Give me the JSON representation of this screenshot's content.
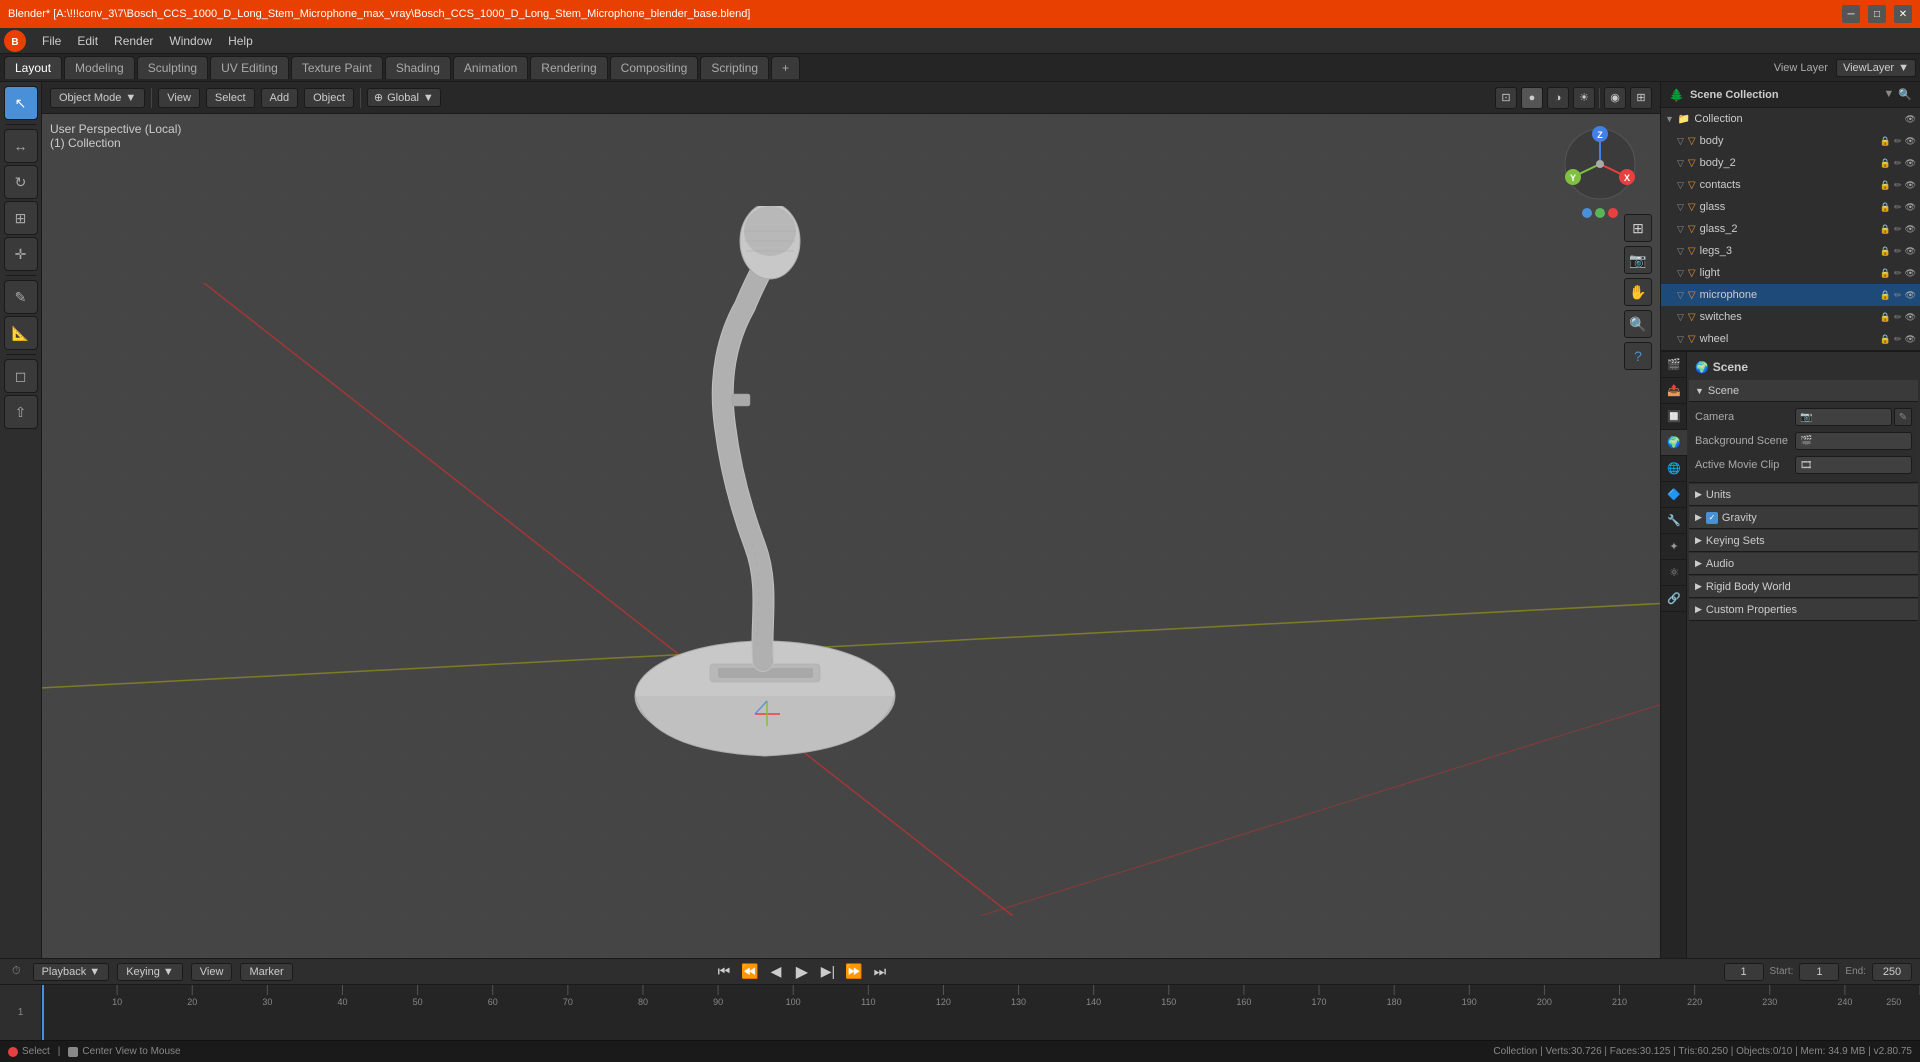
{
  "window": {
    "title": "Blender* [A:\\!!!conv_3\\7\\Bosch_CCS_1000_D_Long_Stem_Microphone_max_vray\\Bosch_CCS_1000_D_Long_Stem_Microphone_blender_base.blend]"
  },
  "menu": {
    "logo": "B",
    "items": [
      "File",
      "Edit",
      "Render",
      "Window",
      "Help"
    ]
  },
  "workspace_tabs": {
    "tabs": [
      "Layout",
      "Modeling",
      "Sculpting",
      "UV Editing",
      "Texture Paint",
      "Shading",
      "Animation",
      "Rendering",
      "Compositing",
      "Scripting",
      "+"
    ],
    "active": "Layout"
  },
  "view_layer": {
    "label": "View Layer",
    "value": "ViewLayer"
  },
  "viewport": {
    "mode_label": "Object Mode",
    "view_label": "User Perspective (Local)",
    "collection_label": "(1) Collection",
    "global_local": "Global",
    "header_icons": [
      "⊞",
      "⊕",
      "☉",
      "⊙",
      "△",
      "⊞"
    ]
  },
  "toolbar": {
    "tools": [
      "↖",
      "↔",
      "↕",
      "↻",
      "⊞",
      "◎",
      "✎",
      "✂"
    ]
  },
  "outliner": {
    "title": "Scene Collection",
    "items": [
      {
        "name": "Collection",
        "indent": 0,
        "icon": "▽",
        "color": "none",
        "type": "collection"
      },
      {
        "name": "body",
        "indent": 1,
        "icon": "▽",
        "color": "orange",
        "type": "mesh",
        "actions": "🔒✏"
      },
      {
        "name": "body_2",
        "indent": 1,
        "icon": "▽",
        "color": "orange",
        "type": "mesh",
        "actions": "🔒✏"
      },
      {
        "name": "contacts",
        "indent": 1,
        "icon": "▽",
        "color": "orange",
        "type": "mesh",
        "actions": "🔒✏"
      },
      {
        "name": "glass",
        "indent": 1,
        "icon": "▽",
        "color": "orange",
        "type": "mesh",
        "actions": "🔒✏"
      },
      {
        "name": "glass_2",
        "indent": 1,
        "icon": "▽",
        "color": "orange",
        "type": "mesh",
        "actions": "🔒✏"
      },
      {
        "name": "legs_3",
        "indent": 1,
        "icon": "▽",
        "color": "orange",
        "type": "mesh",
        "actions": "🔒✏"
      },
      {
        "name": "light",
        "indent": 1,
        "icon": "▽",
        "color": "orange",
        "type": "light",
        "actions": "🔒✏"
      },
      {
        "name": "microphone",
        "indent": 1,
        "icon": "▽",
        "color": "orange",
        "type": "mesh",
        "actions": "🔒✏"
      },
      {
        "name": "switches",
        "indent": 1,
        "icon": "▽",
        "color": "orange",
        "type": "mesh",
        "actions": "🔒✏"
      },
      {
        "name": "wheel",
        "indent": 1,
        "icon": "▽",
        "color": "orange",
        "type": "mesh",
        "actions": "🔒✏"
      }
    ]
  },
  "properties": {
    "tabs": [
      "🎬",
      "📷",
      "✦",
      "🌍",
      "🔧",
      "🎭",
      "🔷",
      "🧲",
      "⚙"
    ],
    "active_tab": "🌍",
    "scene_label": "Scene",
    "sections": [
      {
        "name": "Scene",
        "collapsed": false,
        "fields": [
          {
            "label": "Camera",
            "value": "",
            "icon": "📷"
          },
          {
            "label": "Background Scene",
            "value": "",
            "icon": "🎬"
          },
          {
            "label": "Active Movie Clip",
            "value": "",
            "icon": "🎞"
          }
        ]
      },
      {
        "name": "Units",
        "collapsed": true,
        "fields": []
      },
      {
        "name": "Gravity",
        "collapsed": true,
        "checked": true,
        "fields": []
      },
      {
        "name": "Keying Sets",
        "collapsed": true,
        "fields": []
      },
      {
        "name": "Audio",
        "collapsed": true,
        "fields": []
      },
      {
        "name": "Rigid Body World",
        "collapsed": true,
        "fields": []
      },
      {
        "name": "Custom Properties",
        "collapsed": true,
        "fields": []
      }
    ]
  },
  "timeline": {
    "playback_label": "Playback",
    "keying_label": "Keying",
    "view_label": "View",
    "marker_label": "Marker",
    "current_frame": "1",
    "start_frame": "1",
    "end_frame": "250",
    "markers": [
      1,
      50,
      100,
      150,
      200,
      250
    ],
    "ruler_marks": [
      1,
      10,
      20,
      30,
      40,
      50,
      60,
      70,
      80,
      90,
      100,
      110,
      120,
      130,
      140,
      150,
      160,
      170,
      180,
      190,
      200,
      210,
      220,
      230,
      240,
      250
    ]
  },
  "status_bar": {
    "left": "● Select",
    "middle": "⊕ Center View to Mouse",
    "right": "Collection | Verts:30.726 | Faces:30.125 | Tris:60.250 | Objects:0/10 | Mem: 34.9 MB | v2.80.75"
  },
  "nav_gizmo": {
    "x_color": "#e84040",
    "y_color": "#80c040",
    "z_color": "#4080e8"
  },
  "colors": {
    "accent": "#4a90d9",
    "orange": "#e8943a",
    "red": "#e84000",
    "green": "#5ab55a",
    "bg_dark": "#1a1a1a",
    "bg_panel": "#2e2e2e",
    "bg_mid": "#3a3a3a",
    "bg_viewport": "#454545"
  }
}
